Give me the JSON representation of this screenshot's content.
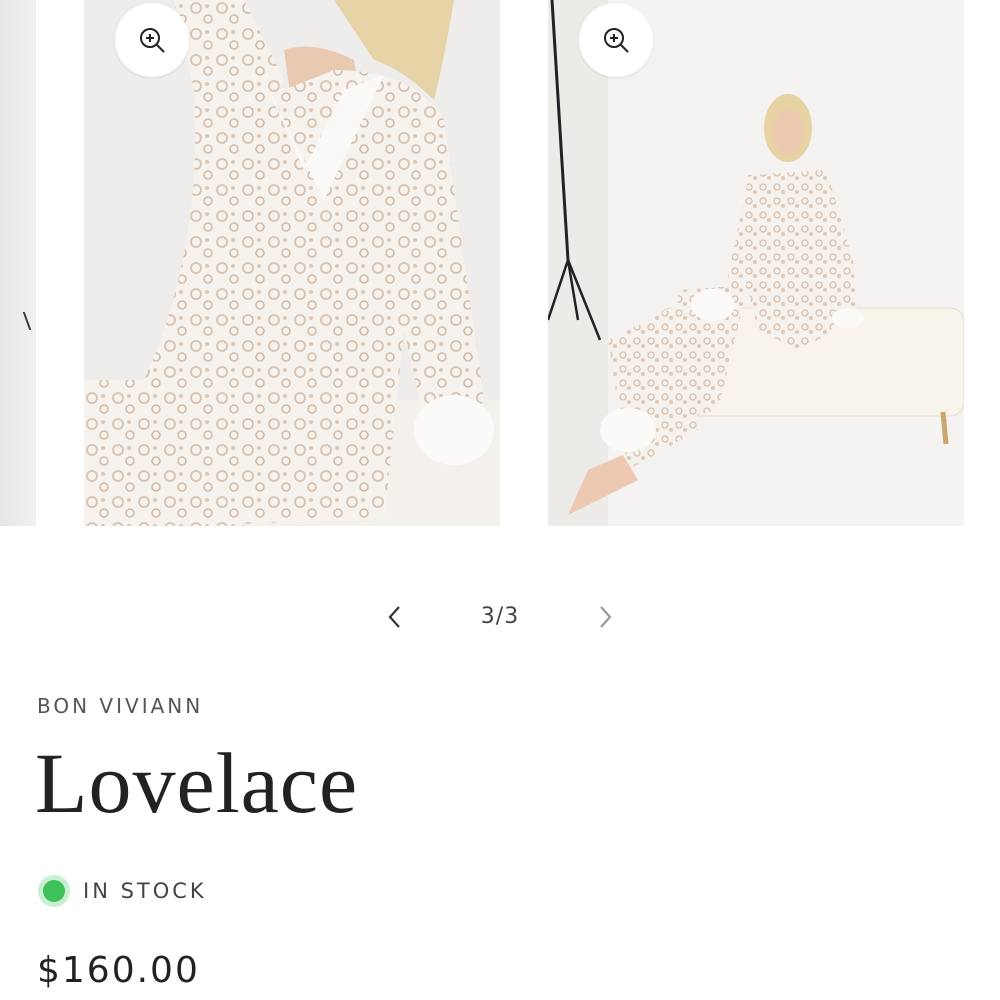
{
  "gallery": {
    "images": [
      {
        "alt": "model-seated-lace-pajama-closeup",
        "zoom_icon": "zoom-in-icon"
      },
      {
        "alt": "model-seated-on-bench-full-length",
        "zoom_icon": "zoom-in-icon"
      }
    ],
    "pager": {
      "prev_icon": "chevron-left-icon",
      "counter": "3/3",
      "next_icon": "chevron-right-icon"
    }
  },
  "product": {
    "vendor": "BON VIVIANN",
    "title": "Lovelace",
    "availability": "IN STOCK",
    "availability_color": "#3ec05a",
    "price": "$160.00"
  }
}
